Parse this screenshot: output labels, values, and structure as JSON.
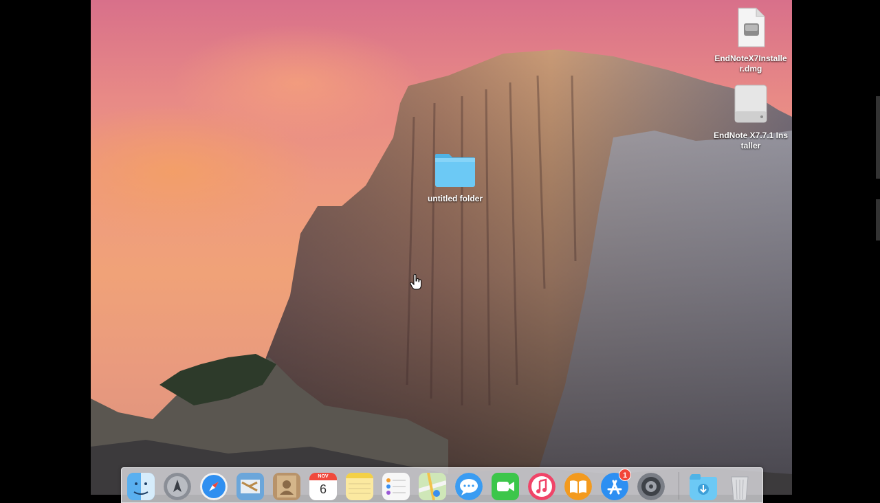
{
  "desktop": {
    "icons": [
      {
        "label": "EndNoteX7Installer.dmg",
        "icon": "disk-image-icon"
      },
      {
        "label": "EndNote X7.7.1 Installer",
        "icon": "mounted-volume-icon"
      },
      {
        "label": "untitled folder",
        "icon": "folder-icon"
      }
    ],
    "wallpaper": "yosemite-half-dome"
  },
  "dock": {
    "items": [
      {
        "name": "Finder",
        "icon": "finder-icon"
      },
      {
        "name": "Launchpad",
        "icon": "launchpad-icon"
      },
      {
        "name": "Safari",
        "icon": "safari-icon"
      },
      {
        "name": "Mail",
        "icon": "mail-icon"
      },
      {
        "name": "Contacts",
        "icon": "contacts-icon"
      },
      {
        "name": "Calendar",
        "icon": "calendar-icon"
      },
      {
        "name": "Notes",
        "icon": "notes-icon"
      },
      {
        "name": "Reminders",
        "icon": "reminders-icon"
      },
      {
        "name": "Maps",
        "icon": "maps-icon"
      },
      {
        "name": "Messages",
        "icon": "messages-icon"
      },
      {
        "name": "FaceTime",
        "icon": "facetime-icon"
      },
      {
        "name": "iTunes",
        "icon": "itunes-icon"
      },
      {
        "name": "iBooks",
        "icon": "ibooks-icon"
      },
      {
        "name": "App Store",
        "icon": "app-store-icon"
      },
      {
        "name": "System Preferences",
        "icon": "system-preferences-icon"
      },
      {
        "name": "Downloads",
        "icon": "downloads-folder-icon"
      },
      {
        "name": "Trash",
        "icon": "trash-icon"
      }
    ],
    "calendar": {
      "month": "NOV",
      "day": "6"
    },
    "app_store_badge": "1"
  },
  "colors": {
    "folder_blue": "#5fc3f2",
    "dock_background": "#e1e1e6",
    "badge_red": "#f2463a"
  }
}
